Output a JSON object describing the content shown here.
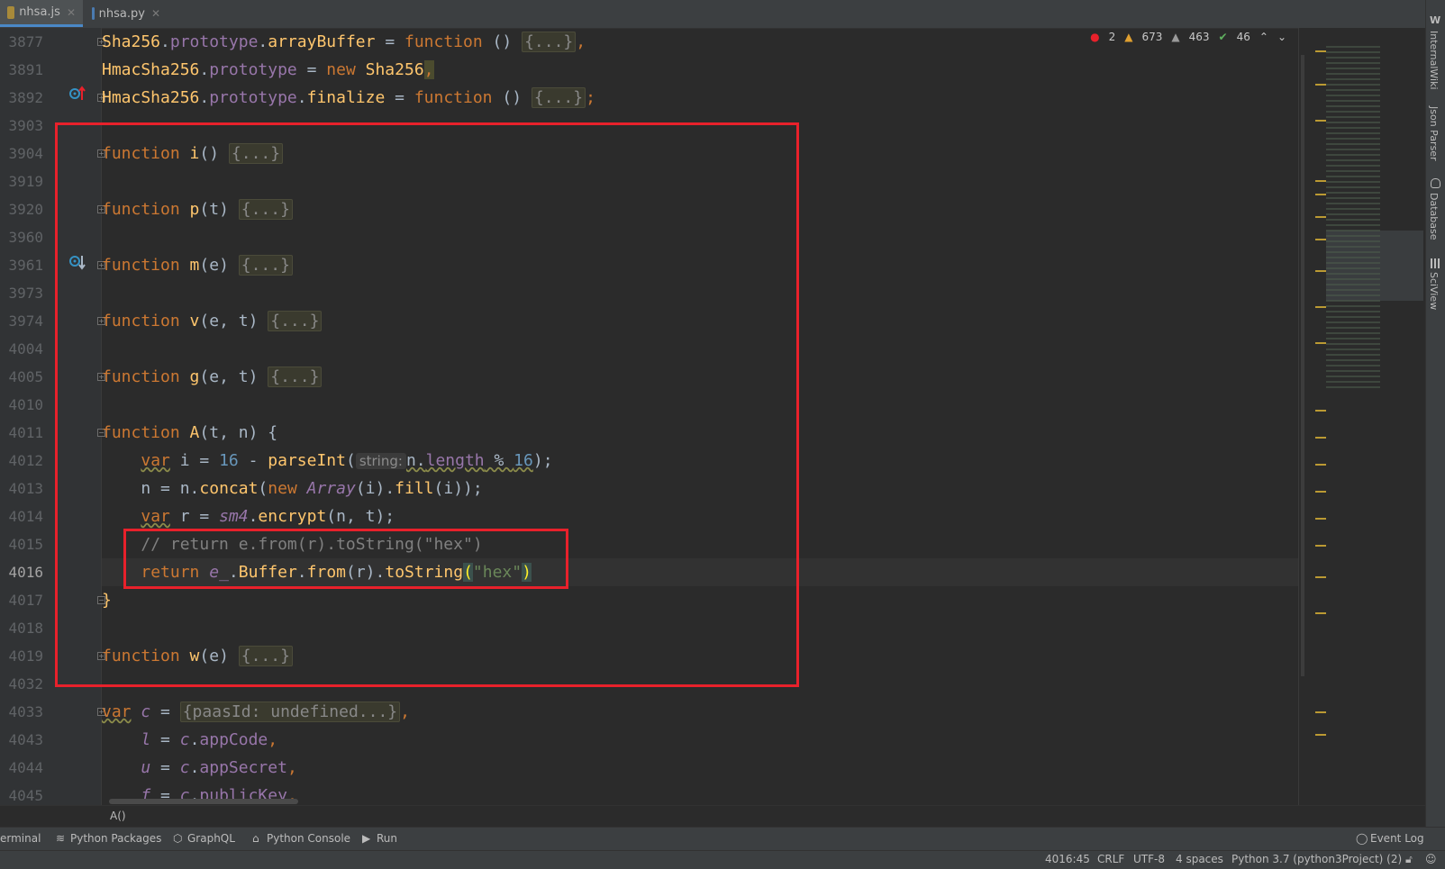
{
  "tabs": [
    {
      "label": "nhsa.js",
      "active": true
    },
    {
      "label": "nhsa.py",
      "active": false
    }
  ],
  "inspections": {
    "errors": "2",
    "warnings": "673",
    "weak_warnings": "463",
    "ok": "46"
  },
  "line_numbers": [
    "3877",
    "3891",
    "3892",
    "3903",
    "3904",
    "3919",
    "3920",
    "3960",
    "3961",
    "3973",
    "3974",
    "4004",
    "4005",
    "4010",
    "4011",
    "4012",
    "4013",
    "4014",
    "4015",
    "4016",
    "4017",
    "4018",
    "4019",
    "4032",
    "4033",
    "4043",
    "4044",
    "4045"
  ],
  "current_line": "4016",
  "code": {
    "l3877": {
      "a": "Sha256",
      "b": ".",
      "c": "prototype",
      "d": ".",
      "e": "arrayBuffer",
      "f": " = ",
      "g": "function",
      "h": " () ",
      "i": "{...}",
      "j": ","
    },
    "l3891": {
      "a": "HmacSha256",
      "b": ".",
      "c": "prototype",
      "d": " = ",
      "e": "new",
      "f": " Sha256",
      "g": ","
    },
    "l3892": {
      "a": "HmacSha256",
      "b": ".",
      "c": "prototype",
      "d": ".",
      "e": "finalize",
      "f": " = ",
      "g": "function",
      "h": " () ",
      "i": "{...}",
      "j": ";"
    },
    "l3904": {
      "kw": "function",
      "name": " i",
      "args": "() ",
      "body": "{...}"
    },
    "l3920": {
      "kw": "function",
      "name": " p",
      "args": "(t) ",
      "body": "{...}"
    },
    "l3961": {
      "kw": "function",
      "name": " m",
      "args": "(e) ",
      "body": "{...}"
    },
    "l3974": {
      "kw": "function",
      "name": " v",
      "args": "(e, t) ",
      "body": "{...}"
    },
    "l4005": {
      "kw": "function",
      "name": " g",
      "args": "(e, t) ",
      "body": "{...}"
    },
    "l4011": {
      "kw": "function",
      "name": " A",
      "args": "(t, n) {"
    },
    "l4012": {
      "indent": "    ",
      "var": "var",
      "a": " i = ",
      "num1": "16",
      "b": " - ",
      "fn": "parseInt",
      "c": "(",
      "hint": "string:",
      "d": "n.",
      "prop": "length",
      "e": " % ",
      "num2": "16",
      "f": ");"
    },
    "l4013": {
      "indent": "    ",
      "a": "n = n.",
      "fn": "concat",
      "b": "(",
      "new": "new",
      "c": " ",
      "cls": "Array",
      "d": "(i).",
      "fn2": "fill",
      "e": "(i));"
    },
    "l4014": {
      "indent": "    ",
      "var": "var",
      "a": " r = ",
      "obj": "sm4",
      "b": ".",
      "fn": "encrypt",
      "c": "(n, t);"
    },
    "l4015": {
      "indent": "    ",
      "comment": "// return e.from(r).toString(\"hex\")"
    },
    "l4016": {
      "indent": "    ",
      "kw": "return",
      "a": " ",
      "obj": "e_",
      "b": ".",
      "cls": "Buffer",
      "c": ".",
      "fn": "from",
      "d": "(r).",
      "fn2": "toString",
      "e": "(",
      "str": "\"hex\"",
      "f": ")"
    },
    "l4017": {
      "a": "}"
    },
    "l4019": {
      "kw": "function",
      "name": " w",
      "args": "(e) ",
      "body": "{...}"
    },
    "l4033": {
      "var": "var",
      "a": " ",
      "obj": "c",
      "b": " = ",
      "body": "{paasId: undefined...}",
      "c": ","
    },
    "l4043": {
      "indent": "    ",
      "obj": "l",
      "a": " = ",
      "obj2": "c",
      "b": ".",
      "prop": "appCode",
      "c": ","
    },
    "l4044": {
      "indent": "    ",
      "obj": "u",
      "a": " = ",
      "obj2": "c",
      "b": ".",
      "prop": "appSecret",
      "c": ","
    },
    "l4045": {
      "indent": "    ",
      "obj": "f",
      "a": " = ",
      "obj2": "c",
      "b": ".",
      "prop": "publicKey",
      "c": ","
    }
  },
  "right_tabs": [
    "InternalWiki",
    "Json Parser",
    "Database",
    "SciView"
  ],
  "breadcrumb": "A()",
  "tool_windows": [
    "erminal",
    "Python Packages",
    "GraphQL",
    "Python Console",
    "Run"
  ],
  "event_log": "Event Log",
  "status": {
    "position": "4016:45",
    "line_sep": "CRLF",
    "encoding": "UTF-8",
    "indent": "4 spaces",
    "interpreter": "Python 3.7 (python3Project) (2)"
  },
  "colors": {
    "highlight_box": "#e8212b",
    "keyword": "#cc7832",
    "function": "#ffc66d",
    "number": "#6897bb",
    "string": "#6a8759"
  }
}
